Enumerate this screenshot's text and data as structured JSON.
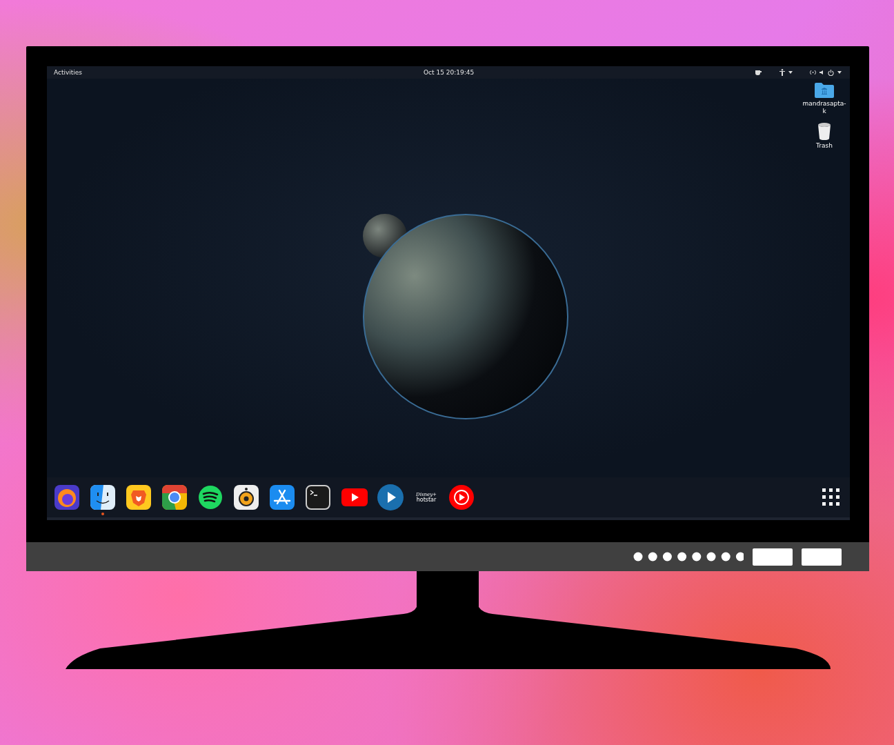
{
  "top_bar": {
    "activities": "Activities",
    "clock": "Oct 15  20:19:45"
  },
  "desktop_icons": [
    {
      "kind": "folder",
      "label": "mandrasapta-k"
    },
    {
      "kind": "trash",
      "label": "Trash"
    }
  ],
  "dock": [
    {
      "kind": "firefox",
      "running": false
    },
    {
      "kind": "finder",
      "running": true
    },
    {
      "kind": "brave",
      "running": false
    },
    {
      "kind": "chrome",
      "running": false
    },
    {
      "kind": "spotify",
      "running": false
    },
    {
      "kind": "speaker",
      "running": false
    },
    {
      "kind": "appstore",
      "running": false
    },
    {
      "kind": "terminal",
      "running": false
    },
    {
      "kind": "youtube",
      "running": false
    },
    {
      "kind": "player",
      "running": false
    },
    {
      "kind": "hotstar",
      "running": false,
      "logo_text": [
        "Disney+",
        "hotstar"
      ]
    },
    {
      "kind": "ytmusic",
      "running": false
    }
  ]
}
